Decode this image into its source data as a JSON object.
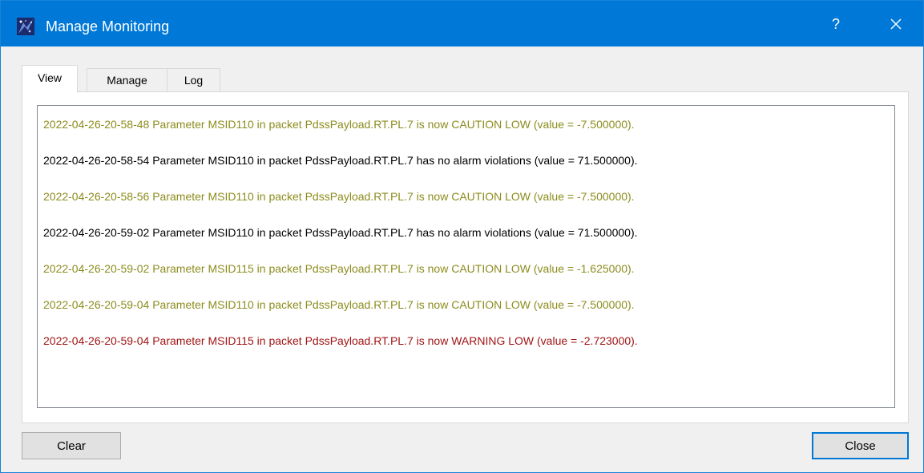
{
  "window": {
    "title": "Manage Monitoring",
    "help_label": "?"
  },
  "tabs": [
    {
      "label": "View",
      "active": true
    },
    {
      "label": "Manage",
      "active": false
    },
    {
      "label": "Log",
      "active": false
    }
  ],
  "log": {
    "lines": [
      {
        "text": "2022-04-26-20-58-48  Parameter MSID110 in packet PdssPayload.RT.PL.7 is now CAUTION LOW (value = -7.500000).",
        "level": "caution"
      },
      {
        "text": "2022-04-26-20-58-54  Parameter MSID110 in packet PdssPayload.RT.PL.7 has no alarm violations (value = 71.500000).",
        "level": "normal"
      },
      {
        "text": "2022-04-26-20-58-56  Parameter MSID110 in packet PdssPayload.RT.PL.7 is now CAUTION LOW (value = -7.500000).",
        "level": "caution"
      },
      {
        "text": "2022-04-26-20-59-02  Parameter MSID110 in packet PdssPayload.RT.PL.7 has no alarm violations (value = 71.500000).",
        "level": "normal"
      },
      {
        "text": "2022-04-26-20-59-02  Parameter MSID115 in packet PdssPayload.RT.PL.7 is now CAUTION LOW (value = -1.625000).",
        "level": "caution"
      },
      {
        "text": "2022-04-26-20-59-04  Parameter MSID110 in packet PdssPayload.RT.PL.7 is now CAUTION LOW (value = -7.500000).",
        "level": "caution"
      },
      {
        "text": "2022-04-26-20-59-04  Parameter MSID115 in packet PdssPayload.RT.PL.7 is now WARNING LOW (value = -2.723000).",
        "level": "warning"
      }
    ],
    "colors": {
      "normal": "#000000",
      "caution": "#8c8c1e",
      "warning": "#a01414"
    }
  },
  "buttons": {
    "clear_label": "Clear",
    "close_label": "Close"
  },
  "icons": {
    "app": "application-logo-icon",
    "close": "close-icon"
  },
  "colors": {
    "titlebar": "#0078d7"
  }
}
